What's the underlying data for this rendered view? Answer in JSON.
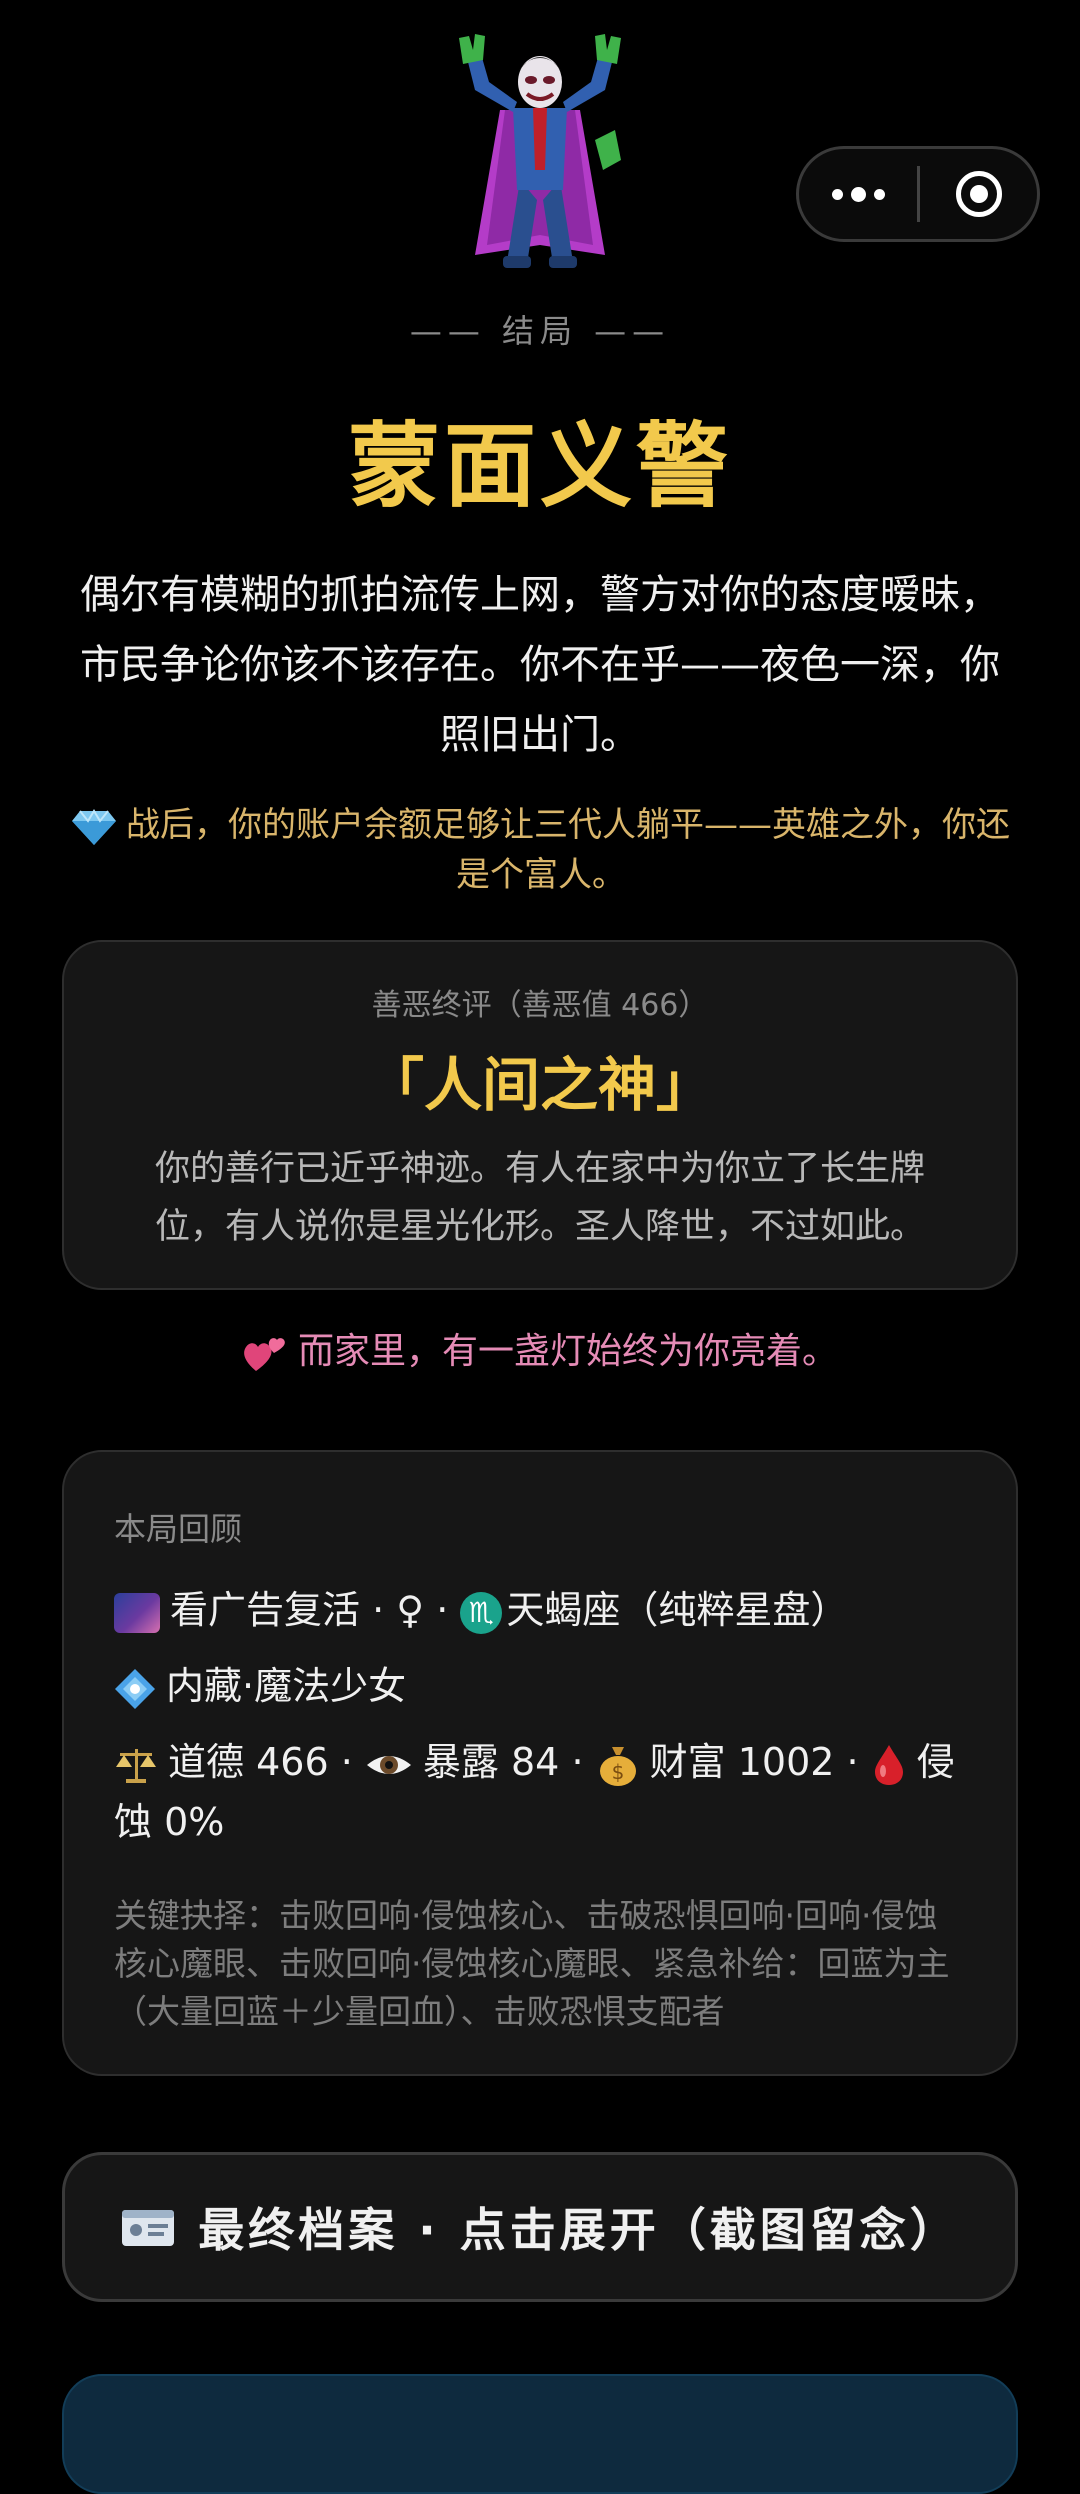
{
  "capsule": {
    "more_icon": "more-dots-icon",
    "close_icon": "target-circle-icon"
  },
  "ending": {
    "label": "—— 结局 ——",
    "title": "蒙面义警",
    "description": "偶尔有模糊的抓拍流传上网，警方对你的态度暧昧，市民争论你该不该存在。你不在乎——夜色一深，你照旧出门。",
    "wealth_icon": "gem-stone-icon",
    "wealth_text": "战后，你的账户余额足够让三代人躺平——英雄之外，你还是个富人。"
  },
  "verdict": {
    "label": "善恶终评（善恶值 466）",
    "title": "「人间之神」",
    "text": "你的善行已近乎神迹。有人在家中为你立了长生牌位，有人说你是星光化形。圣人降世，不过如此。"
  },
  "family": {
    "icon": "two-hearts-icon",
    "text": "而家里，有一盏灯始终为你亮着。"
  },
  "review": {
    "label": "本局回顾",
    "line1": {
      "revive": "看广告复活",
      "sep1": " · ",
      "gender": "♀",
      "sep2": " · ",
      "zodiac_symbol": "♏",
      "zodiac": "天蝎座（纯粹星盘）"
    },
    "line2": {
      "hidden": "内藏·魔法少女"
    },
    "stats": {
      "morality_label": "道德",
      "morality": "466",
      "exposure_label": "暴露",
      "exposure": "84",
      "wealth_label": "财富",
      "wealth": "1002",
      "corrosion_label": "侵蚀",
      "corrosion": "0%",
      "separator": " · "
    },
    "key_choices": "关键抉择：击败回响·侵蚀核心、击破恐惧回响·回响·侵蚀核心魔眼、击败回响·侵蚀核心魔眼、紧急补给：回蓝为主（大量回蓝＋少量回血）、击败恐惧支配者"
  },
  "archive": {
    "icon": "id-card-icon",
    "label": "最终档案 · 点击展开（截图留念）"
  },
  "colors": {
    "title_gold": "#f2c94c",
    "wealth_gold": "#d9b56b",
    "family_pink": "#e58bb6",
    "card_bg": "#161616",
    "page_bg": "#000000"
  }
}
